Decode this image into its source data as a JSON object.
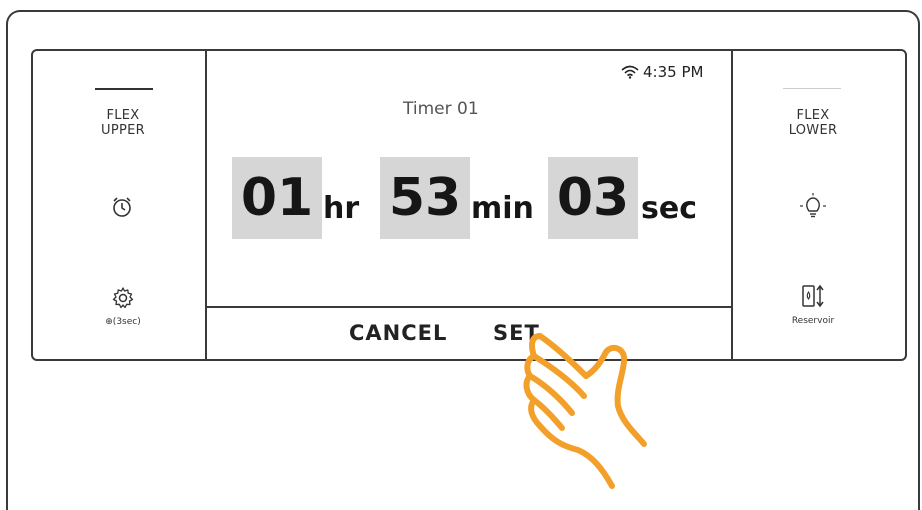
{
  "left_panel": {
    "flex_upper_line1": "FLEX",
    "flex_upper_line2": "UPPER",
    "settings_hint": "⊕(3sec)"
  },
  "right_panel": {
    "flex_lower_line1": "FLEX",
    "flex_lower_line2": "LOWER",
    "reservoir_label": "Reservoir"
  },
  "status_bar": {
    "time": "4:35 PM"
  },
  "timer": {
    "title": "Timer 01",
    "hours": "01",
    "hours_unit": "hr",
    "minutes": "53",
    "minutes_unit": "min",
    "seconds": "03",
    "seconds_unit": "sec"
  },
  "actions": {
    "cancel_label": "CANCEL",
    "set_label": "SET"
  },
  "colors": {
    "hand_accent": "#f2a02a",
    "digit_background": "#d6d6d6"
  },
  "icons": [
    "alarm-clock-icon",
    "gear-icon",
    "lock-icon",
    "light-bulb-icon",
    "reservoir-icon",
    "wifi-icon",
    "hand-pointer-icon"
  ]
}
